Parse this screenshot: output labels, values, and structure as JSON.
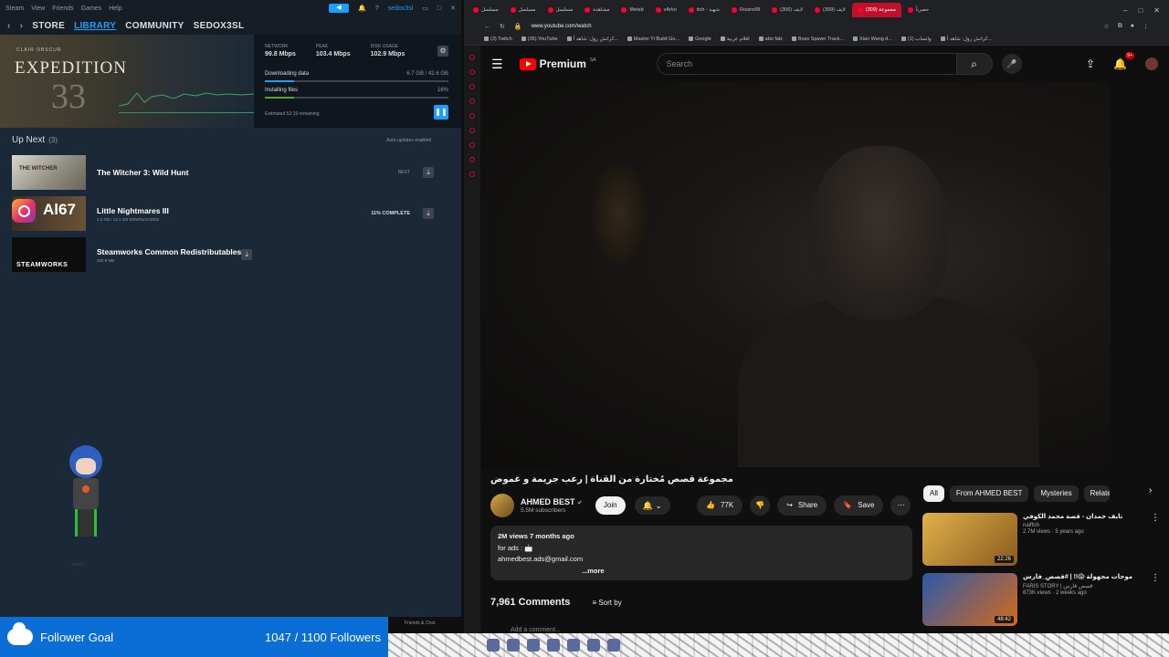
{
  "steam": {
    "menu": [
      "Steam",
      "View",
      "Friends",
      "Games",
      "Help"
    ],
    "username": "sedox3sl",
    "nav": {
      "store": "STORE",
      "library": "LIBRARY",
      "community": "COMMUNITY",
      "profile": "SEDOX3SL"
    },
    "hero": {
      "game_subtitle": "CLAIR OBSCUR",
      "game_title": "EXPEDITION",
      "game_number": "33",
      "network_label": "NETWORK",
      "network_value": "99.8 Mbps",
      "peak_label": "PEAK",
      "peak_value": "103.4 Mbps",
      "disk_label": "DISK USAGE",
      "disk_value": "102.9 Mbps",
      "downloading_label": "Downloading data",
      "downloading_value": "6.7 GB / 42.6 GB",
      "download_progress": 0.157,
      "installing_label": "Installing files",
      "installing_value": "16%",
      "installing_progress": 0.16,
      "eta": "Estimated 52:19 remaining"
    },
    "up_next": {
      "title": "Up Next",
      "count": "(3)",
      "auto_updates": "Auto-updates enabled",
      "items": [
        {
          "name": "The Witcher 3: Wild Hunt",
          "meta": "",
          "status": "NEXT",
          "thumb_text": "THE WITCHER"
        },
        {
          "name": "Little Nightmares III",
          "meta": "1.2 GB / 13.1 GB DOWNLOADED",
          "status": "11% COMPLETE",
          "thumb_text": "Al67"
        },
        {
          "name": "Steamworks Common Redistributables",
          "meta": "250.9 MB",
          "status": "",
          "thumb_text": "STEAMWORKS"
        }
      ]
    },
    "mascot_label": "sedox",
    "friends_chat": "Friends & Chat"
  },
  "follower_goal": {
    "label": "Follower Goal",
    "progress_text": "1047 / 1100 Followers"
  },
  "browser": {
    "tabs": [
      {
        "label": "مسلسل",
        "active": false
      },
      {
        "label": "مسلسل",
        "active": false
      },
      {
        "label": "مسلسل",
        "active": false
      },
      {
        "label": "مشاهدة",
        "active": false
      },
      {
        "label": "Meteb",
        "active": false
      },
      {
        "label": "vArko",
        "active": false
      },
      {
        "label": "itch - شهيد",
        "active": false
      },
      {
        "label": "Rooire98",
        "active": false
      },
      {
        "label": "(306) لايف",
        "active": false
      },
      {
        "label": "(309) لايف",
        "active": false
      },
      {
        "label": "(309) مجموعة",
        "active": true
      },
      {
        "label": "حصرياً",
        "active": false
      }
    ],
    "url": "www.youtube.com/watch",
    "bookmarks": [
      "(3) Twitch",
      "(35) YouTube",
      "كرانش رول: شاهد أ...",
      "Master Yi Build Gu...",
      "Google",
      "افلام عربية",
      "abo falz",
      "Boss Spawn Track...",
      "Xian Wang d...",
      "(1) واتساب",
      "كرانش رول: شاهد أ..."
    ]
  },
  "youtube": {
    "logo": "Premium",
    "country": "SA",
    "search_placeholder": "Search",
    "notifications": "9+",
    "video_title": "مجموعة قصص مُختارة من القناة | رعب جريمة و غموض",
    "channel": "AHMED BEST",
    "subscribers": "5.5M subscribers",
    "join": "Join",
    "likes": "77K",
    "share": "Share",
    "save": "Save",
    "description": {
      "stats": "2M views  7 months ago",
      "line1": "for ads : 📩",
      "line2": "ahmedbest.ads@gmail.com",
      "more": "...more"
    },
    "comments_count": "7,961 Comments",
    "sort_by": "Sort by",
    "add_comment": "Add a comment...",
    "chips": [
      "All",
      "From AHMED BEST",
      "Mysteries",
      "Related"
    ],
    "recommendations": [
      {
        "title": "نايف حمدان - قصة محمد الكوفي",
        "channel": "naiffoh",
        "meta": "2.7M views · 5 years ago",
        "duration": "22:26"
      },
      {
        "title": "موجات مجهولة 😱!! | #قصص_فارس",
        "channel": "FARIS STORY | قصص فارس",
        "meta": "873K views · 2 weeks ago",
        "duration": "48:42"
      }
    ]
  },
  "colors": {
    "steam_bg": "#1b2838",
    "steam_accent": "#1a9fff",
    "youtube_bg": "#0f0f0f",
    "youtube_red": "#ff0000",
    "follower_blue": "#0a6ed6"
  }
}
